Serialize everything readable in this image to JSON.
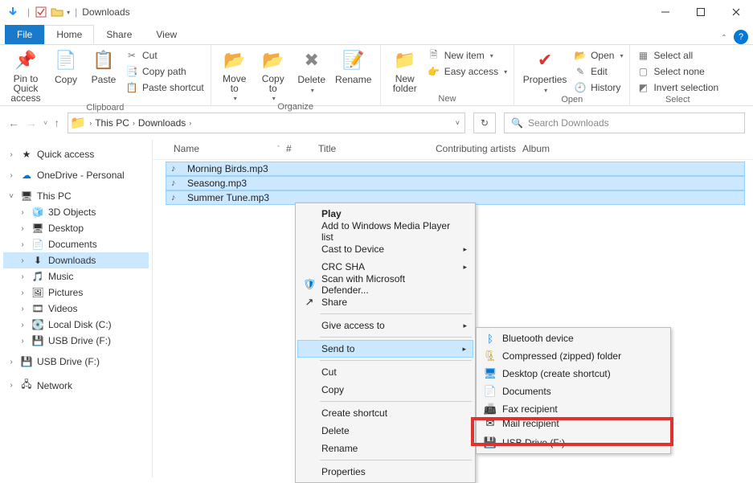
{
  "title": "Downloads",
  "tabs": {
    "file": "File",
    "home": "Home",
    "share": "Share",
    "view": "View"
  },
  "ribbon": {
    "clipboard": {
      "label": "Clipboard",
      "pin": "Pin to Quick\naccess",
      "copy": "Copy",
      "paste": "Paste",
      "cut": "Cut",
      "copypath": "Copy path",
      "pasteshortcut": "Paste shortcut"
    },
    "organize": {
      "label": "Organize",
      "moveto": "Move\nto",
      "copyto": "Copy\nto",
      "delete": "Delete",
      "rename": "Rename"
    },
    "new": {
      "label": "New",
      "newfolder": "New\nfolder",
      "newitem": "New item",
      "easyaccess": "Easy access"
    },
    "open": {
      "label": "Open",
      "properties": "Properties",
      "open": "Open",
      "edit": "Edit",
      "history": "History"
    },
    "select": {
      "label": "Select",
      "selectall": "Select all",
      "selectnone": "Select none",
      "invert": "Invert selection"
    }
  },
  "breadcrumb": {
    "root": "This PC",
    "current": "Downloads"
  },
  "search_placeholder": "Search Downloads",
  "tree": {
    "quickaccess": "Quick access",
    "onedrive": "OneDrive - Personal",
    "thispc": "This PC",
    "objects3d": "3D Objects",
    "desktop": "Desktop",
    "documents": "Documents",
    "downloads": "Downloads",
    "music": "Music",
    "pictures": "Pictures",
    "videos": "Videos",
    "localdisk": "Local Disk (C:)",
    "usbdrive1": "USB Drive (F:)",
    "usbdrive2": "USB Drive (F:)",
    "network": "Network"
  },
  "columns": {
    "name": "Name",
    "num": "#",
    "title": "Title",
    "contrib": "Contributing artists",
    "album": "Album"
  },
  "files": [
    {
      "name": "Morning Birds.mp3"
    },
    {
      "name": "Seasong.mp3"
    },
    {
      "name": "Summer Tune.mp3"
    }
  ],
  "context_menu": {
    "play": "Play",
    "addwmp": "Add to Windows Media Player list",
    "cast": "Cast to Device",
    "crc": "CRC SHA",
    "scan": "Scan with Microsoft Defender...",
    "share": "Share",
    "giveaccess": "Give access to",
    "sendto": "Send to",
    "cut": "Cut",
    "copy": "Copy",
    "createshortcut": "Create shortcut",
    "delete": "Delete",
    "rename": "Rename",
    "properties": "Properties"
  },
  "sendto_menu": {
    "bluetooth": "Bluetooth device",
    "compressed": "Compressed (zipped) folder",
    "desktop": "Desktop (create shortcut)",
    "documents": "Documents",
    "fax": "Fax recipient",
    "mail": "Mail recipient",
    "usbdrive": "USB Drive (F:)"
  }
}
